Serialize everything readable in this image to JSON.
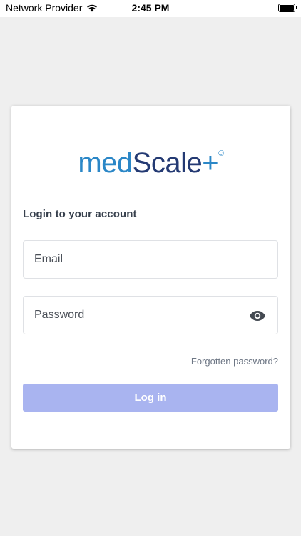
{
  "status_bar": {
    "carrier": "Network Provider",
    "time": "2:45 PM"
  },
  "logo": {
    "part1": "med",
    "part2": "Scale",
    "part3": "+",
    "mark": "©"
  },
  "login": {
    "heading": "Login to your account",
    "email_placeholder": "Email",
    "password_placeholder": "Password",
    "forgot_label": "Forgotten password?",
    "login_label": "Log in"
  },
  "icons": {
    "signal": "wifi-icon",
    "battery": "battery-icon",
    "password_toggle": "eye-icon"
  },
  "colors": {
    "brand_light": "#2b87c7",
    "brand_dark": "#243a73",
    "button": "#a9b4f0"
  }
}
